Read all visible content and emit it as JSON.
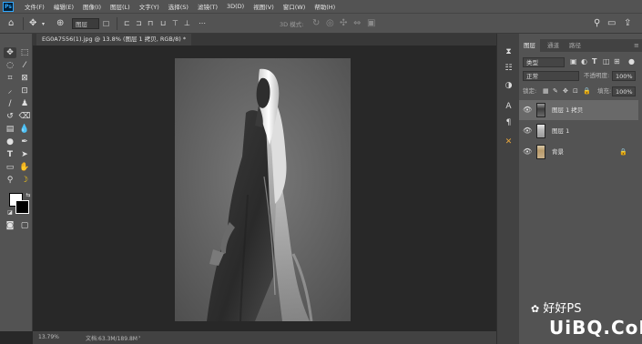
{
  "menu": [
    "文件(F)",
    "编辑(E)",
    "图像(I)",
    "图层(L)",
    "文字(Y)",
    "选择(S)",
    "滤镜(T)",
    "3D(D)",
    "视图(V)",
    "窗口(W)",
    "帮助(H)"
  ],
  "options": {
    "layer_select": "图层",
    "mode_label": "3D 模式:"
  },
  "document_tab": "EG0A7556(1).jpg @ 13.8% (图层 1 拷贝, RGB/8) *",
  "status": {
    "zoom": "13.79%",
    "doc_size": "文档:63.3M/189.8M"
  },
  "colors": {
    "foreground": "#ffffff",
    "background": "#000000",
    "accent": "#e8a63c"
  },
  "panel": {
    "tabs": [
      "图层",
      "通道",
      "路径"
    ],
    "filter_kind": "类型",
    "blend_mode": "正常",
    "opacity_label": "不透明度:",
    "opacity_value": "100%",
    "lock_label": "锁定:",
    "fill_label": "填充:",
    "fill_value": "100%",
    "layers": [
      {
        "name": "图层 1 拷贝",
        "selected": true
      },
      {
        "name": "图层 1",
        "selected": false
      },
      {
        "name": "背景",
        "selected": false,
        "locked": true
      }
    ]
  },
  "watermark": {
    "line1": "好好PS",
    "line2": "UiBQ.CoM"
  }
}
